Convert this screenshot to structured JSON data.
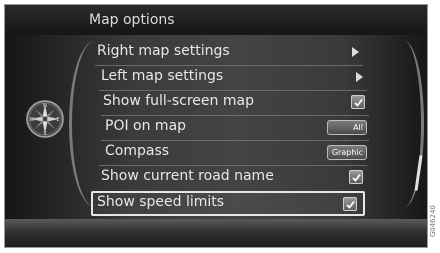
{
  "header": {
    "title": "Map options"
  },
  "menu": {
    "items": [
      {
        "label": "Right map settings",
        "control": "arrow"
      },
      {
        "label": "Left map settings",
        "control": "arrow"
      },
      {
        "label": "Show full-screen map",
        "control": "checkbox",
        "checked": true
      },
      {
        "label": "POI on map",
        "control": "value",
        "value": "All"
      },
      {
        "label": "Compass",
        "control": "value",
        "value": "Graphic"
      },
      {
        "label": "Show current road name",
        "control": "checkbox",
        "checked": true
      },
      {
        "label": "Show speed limits",
        "control": "checkbox",
        "checked": true,
        "selected": true
      }
    ]
  },
  "icons": {
    "compass": "compass-icon",
    "arrow": "chevron-right-icon",
    "checkbox": "checkbox-checked-icon"
  },
  "figure_code": "G046240"
}
